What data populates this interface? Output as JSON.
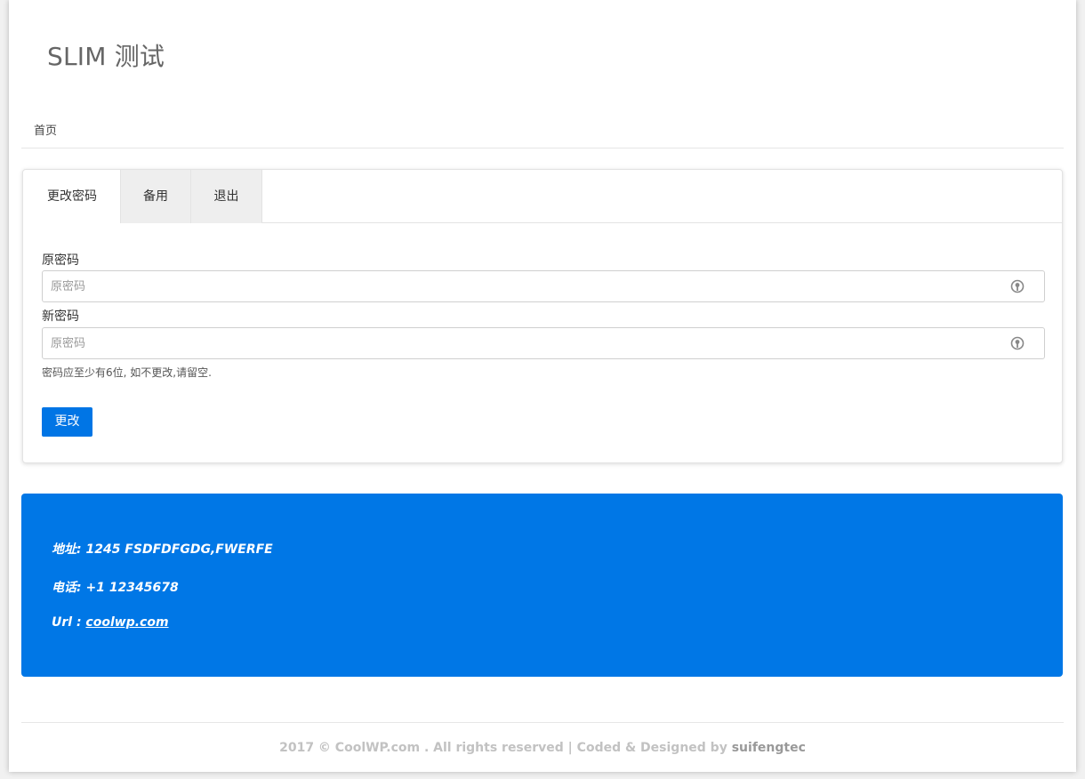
{
  "site": {
    "title": "SLIM 测试"
  },
  "nav": {
    "home": "首页"
  },
  "tabs": [
    {
      "label": "更改密码",
      "active": true
    },
    {
      "label": "备用",
      "active": false
    },
    {
      "label": "退出",
      "active": false
    }
  ],
  "form": {
    "old_password_label": "原密码",
    "old_password_placeholder": "原密码",
    "new_password_label": "新密码",
    "new_password_placeholder": "原密码",
    "help_text": "密码应至少有6位, 如不更改,请留空.",
    "submit_label": "更改"
  },
  "contact": {
    "address": "地址: 1245 FSDFDFGDG,FWERFE",
    "phone": "电话: +1 12345678",
    "url_label": "Url : ",
    "url_link": "coolwp.com"
  },
  "footer": {
    "copyright": "2017 © CoolWP.com . All rights reserved | Coded & Designed by ",
    "author": "suifengtec"
  },
  "colors": {
    "accent": "#0077e6",
    "page_bg": "#f1f1f1"
  },
  "icons": {
    "password_field": "key-icon"
  }
}
